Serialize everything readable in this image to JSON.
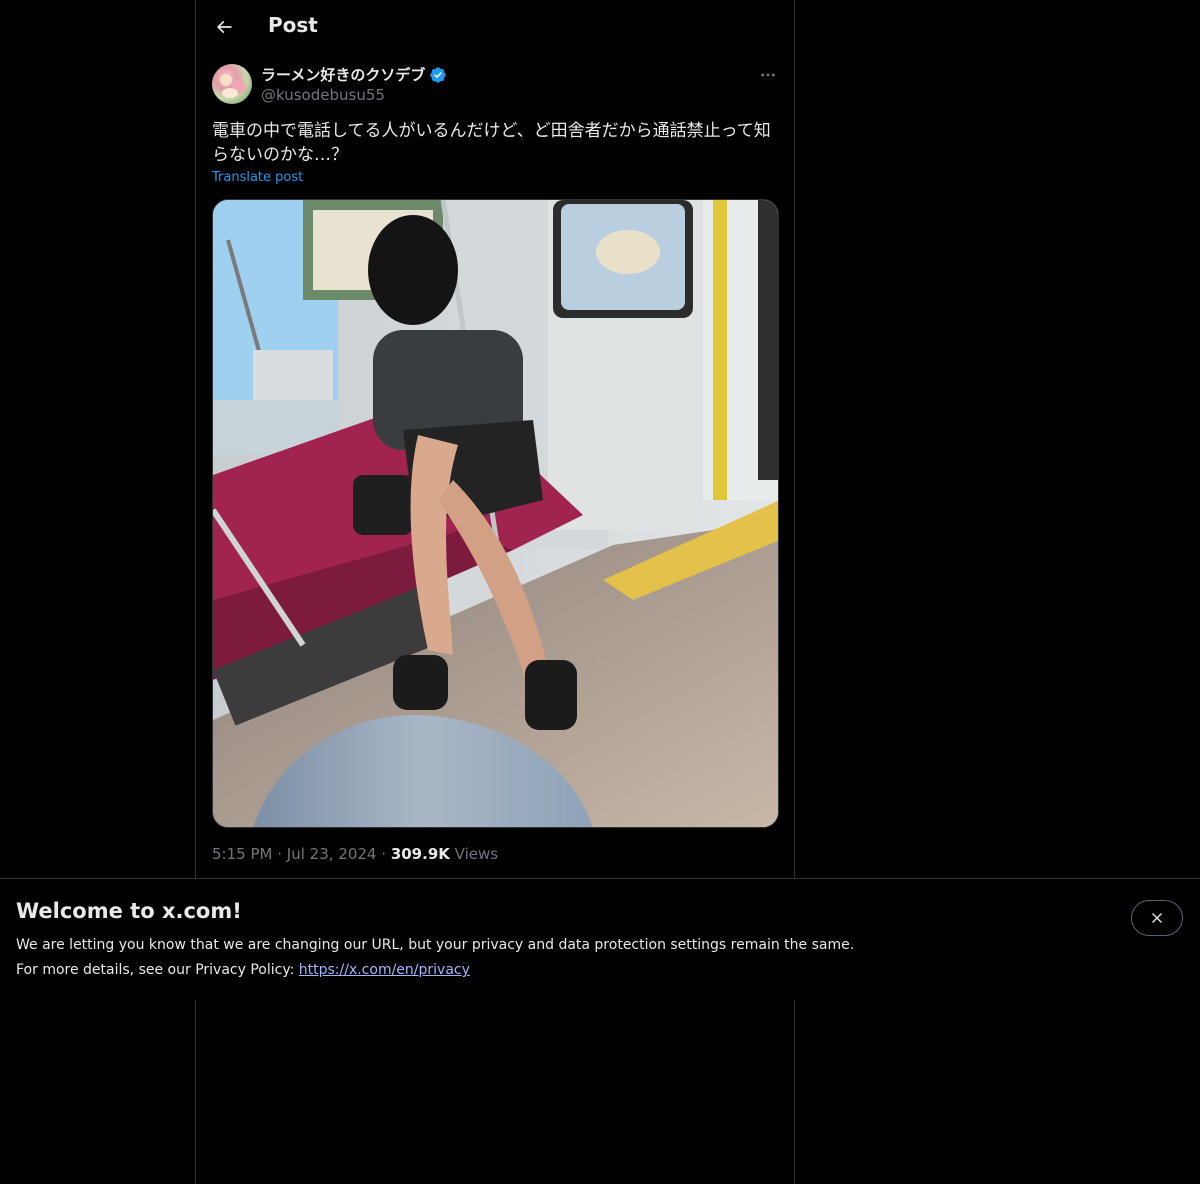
{
  "header": {
    "title": "Post"
  },
  "post": {
    "author_name": "ラーメン好きのクソデブ",
    "author_handle": "@kusodebusu55",
    "text": "電車の中で電話してる人がいるんだけど、ど田舎者だから通話禁止って知らないのかな…？",
    "translate_label": "Translate post",
    "time": "5:15 PM",
    "date": "Jul 23, 2024",
    "views_count": "309.9K",
    "views_label": "Views",
    "separator": "·"
  },
  "banner": {
    "title": "Welcome to x.com!",
    "line1": "We are letting you know that we are changing our URL, but your privacy and data protection settings remain the same.",
    "line2_prefix": "For more details, see our Privacy Policy:",
    "link_text": "https://x.com/en/privacy"
  },
  "colors": {
    "background": "#000000",
    "text": "#e7e9ea",
    "secondary": "#71767b",
    "accent": "#1d9bf0",
    "border": "#2f3336",
    "link": "#a3b4ff"
  },
  "icons": {
    "back": "arrow-left-icon",
    "verified": "verified-badge-icon",
    "more": "more-horizontal-icon",
    "close": "close-icon"
  }
}
